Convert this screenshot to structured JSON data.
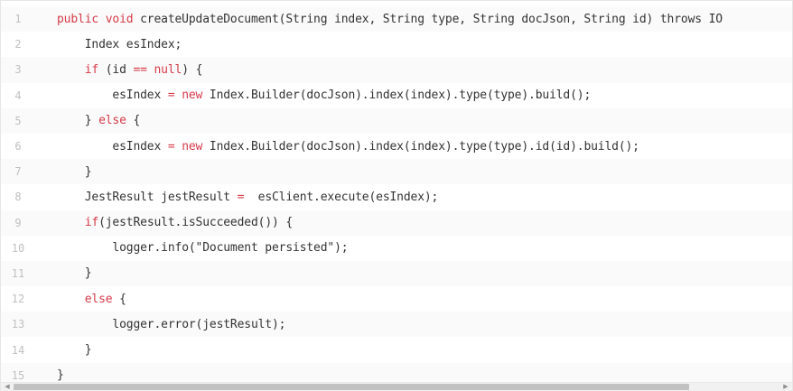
{
  "code": {
    "lines": [
      {
        "num": "1",
        "indent": "",
        "parts": [
          {
            "t": "public void ",
            "c": "kw"
          },
          {
            "t": "createUpdateDocument(String index, String type, String docJson, String id) throws IO",
            "c": ""
          }
        ]
      },
      {
        "num": "2",
        "indent": "    ",
        "parts": [
          {
            "t": "Index esIndex;",
            "c": ""
          }
        ]
      },
      {
        "num": "3",
        "indent": "    ",
        "parts": [
          {
            "t": "if ",
            "c": "kw"
          },
          {
            "t": "(id ",
            "c": ""
          },
          {
            "t": "== null",
            "c": "kw"
          },
          {
            "t": ") {",
            "c": ""
          }
        ]
      },
      {
        "num": "4",
        "indent": "        ",
        "parts": [
          {
            "t": "esIndex ",
            "c": ""
          },
          {
            "t": "= new ",
            "c": "kw"
          },
          {
            "t": "Index.Builder(docJson).index(index).type(type).build();",
            "c": ""
          }
        ]
      },
      {
        "num": "5",
        "indent": "    ",
        "parts": [
          {
            "t": "} ",
            "c": ""
          },
          {
            "t": "else ",
            "c": "kw"
          },
          {
            "t": "{",
            "c": ""
          }
        ]
      },
      {
        "num": "6",
        "indent": "        ",
        "parts": [
          {
            "t": "esIndex ",
            "c": ""
          },
          {
            "t": "= new ",
            "c": "kw"
          },
          {
            "t": "Index.Builder(docJson).index(index).type(type).id(id).build();",
            "c": ""
          }
        ]
      },
      {
        "num": "7",
        "indent": "    ",
        "parts": [
          {
            "t": "}",
            "c": ""
          }
        ]
      },
      {
        "num": "8",
        "indent": "    ",
        "parts": [
          {
            "t": "JestResult jestResult ",
            "c": ""
          },
          {
            "t": "= ",
            "c": "kw"
          },
          {
            "t": " esClient.execute(esIndex);",
            "c": ""
          }
        ]
      },
      {
        "num": "9",
        "indent": "    ",
        "parts": [
          {
            "t": "if",
            "c": "kw"
          },
          {
            "t": "(jestResult.isSucceeded()) {",
            "c": ""
          }
        ]
      },
      {
        "num": "10",
        "indent": "        ",
        "parts": [
          {
            "t": "logger.info(\"Document persisted\");",
            "c": ""
          }
        ]
      },
      {
        "num": "11",
        "indent": "    ",
        "parts": [
          {
            "t": "}",
            "c": ""
          }
        ]
      },
      {
        "num": "12",
        "indent": "    ",
        "parts": [
          {
            "t": "else ",
            "c": "kw"
          },
          {
            "t": "{",
            "c": ""
          }
        ]
      },
      {
        "num": "13",
        "indent": "        ",
        "parts": [
          {
            "t": "logger.error(jestResult);",
            "c": ""
          }
        ]
      },
      {
        "num": "14",
        "indent": "    ",
        "parts": [
          {
            "t": "}",
            "c": ""
          }
        ]
      },
      {
        "num": "15",
        "indent": "",
        "parts": [
          {
            "t": "}",
            "c": ""
          }
        ]
      }
    ]
  },
  "scrollbar": {
    "left_arrow": "◀",
    "right_arrow": "▶"
  },
  "colors": {
    "keyword": "#d73a49",
    "text": "#333333",
    "line_number": "#c0c0c0"
  }
}
